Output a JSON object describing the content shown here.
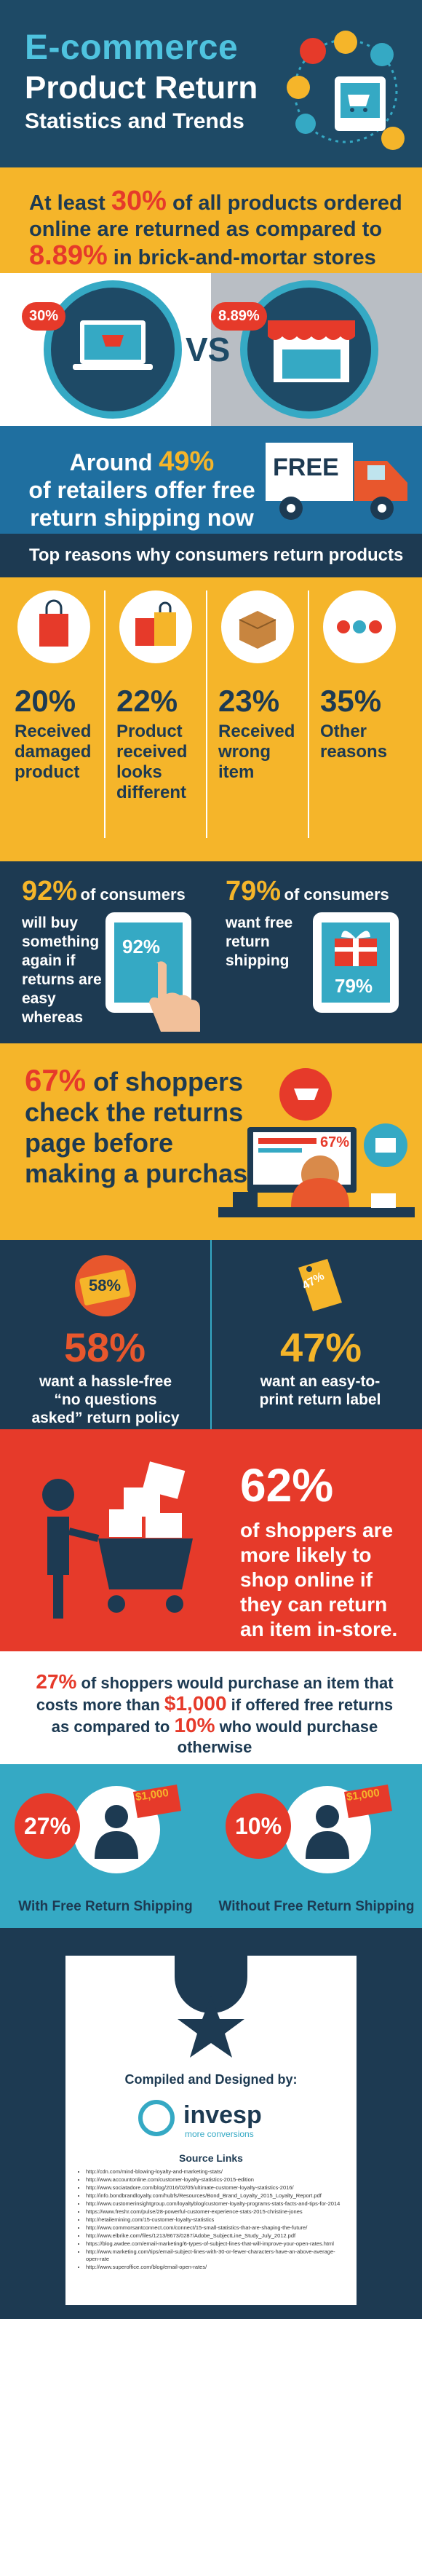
{
  "header": {
    "title_line1": "E-commerce",
    "title_line2": "Product Return",
    "title_line3": "Statistics and Trends"
  },
  "intro": {
    "p1": "At least ",
    "pct1": "30%",
    "p2": " of all products ordered online are returned as compared to ",
    "pct2": "8.89%",
    "p3": " in brick-and-mortar stores"
  },
  "compare": {
    "left_badge": "30%",
    "right_badge": "8.89%",
    "vs": "VS"
  },
  "free_shipping": {
    "line1": "Around ",
    "pct": "49%",
    "line2": "of retailers offer free return shipping now",
    "truck_label": "FREE"
  },
  "reasons": {
    "heading": "Top reasons why consumers return products",
    "items": [
      {
        "pct": "20%",
        "label": "Received damaged product"
      },
      {
        "pct": "22%",
        "label": "Product received looks different"
      },
      {
        "pct": "23%",
        "label": "Received wrong item"
      },
      {
        "pct": "35%",
        "label": "Other reasons"
      }
    ]
  },
  "loyalty": {
    "left_pct": "92%",
    "left_of": "of consumers",
    "left_label": "will buy something again if returns are easy whereas",
    "left_screen": "92%",
    "right_pct": "79%",
    "right_of": "of consumers",
    "right_label": "want free return shipping",
    "right_screen": "79%"
  },
  "check": {
    "pct": "67%",
    "rest": " of shoppers check the returns page before making a purchase",
    "screen": "67%"
  },
  "hassle": {
    "left_tag": "58%",
    "left_pct": "58%",
    "left_label": "want a hassle-free “no questions asked” return policy",
    "right_tag": "47%",
    "right_pct": "47%",
    "right_label": "want an easy-to-print return label"
  },
  "instore": {
    "pct": "62%",
    "label": "of shoppers are more likely to shop online if they can return an item in-store."
  },
  "pay_more": {
    "p1_pct": "27%",
    "p1": " of shoppers would purchase an item that costs more than ",
    "amount": "$1,000",
    "p2": " if offered free returns as compared to ",
    "p2_pct": "10%",
    "p3": " who would purchase otherwise"
  },
  "compare2": {
    "left_pct": "27%",
    "left_tag": "$1,000",
    "left_label": "With Free Return Shipping",
    "right_pct": "10%",
    "right_tag": "$1,000",
    "right_label": "Without Free Return Shipping"
  },
  "footer": {
    "compiled": "Compiled and Designed by:",
    "logo_name": "invesp",
    "logo_tag": "more conversions",
    "links_title": "Source Links",
    "links": [
      "http://cdn.com/mind-blowing-loyalty-and-marketing-stats/",
      "http://www.accountonline.com/customer-loyalty-statistics-2015-edition",
      "http://www.sociatadore.com/blog/2016/02/05/ultimate-customer-loyalty-statistics-2016/",
      "http://info.bondbrandloyalty.com/hubfs/Resources/Bond_Brand_Loyalty_2015_Loyalty_Report.pdf",
      "http://www.customerinsightgroup.com/loyaltyblog/customer-loyalty-programs-stats-facts-and-tips-for-2014",
      "https://www.freshr.com/pulse/28-powerful-customer-experience-stats-2015-christine-jones",
      "http://retailemining.com/15-customer-loyalty-statistics",
      "http://www.commorsantconnect.com/connect/15-small-statistics-that-are-shaping-the-future/",
      "http://www.elbrike.com/files/1213/8673/0287/Adobe_SubjectLine_Study_July_2012.pdf",
      "https://blog.awdee.com/email-marketing/6-types-of-subject-lines-that-will-improve-your-open-rates.html",
      "http://www.marketing.com/tips/email-subject-lines-with-30-or-fewer-characters-have-an-above-average-open-rate",
      "http://www.superoffice.com/blog/email-open-rates/"
    ]
  },
  "colors": {
    "navy": "#1d3a52",
    "header_navy": "#1e4a66",
    "cyan": "#35a9c4",
    "yellow": "#f5b52a",
    "red": "#e63a2a",
    "blue": "#1f6fa0"
  }
}
